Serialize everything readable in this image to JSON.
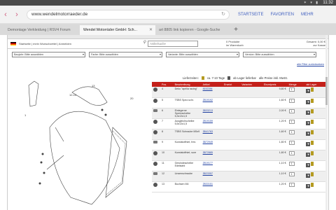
{
  "statusbar": {
    "time": "11:32",
    "icons": "✶ ▾ ▮"
  },
  "browser": {
    "url": "www.wendelmotorraeder.de",
    "links": [
      "STARTSEITE",
      "FAVORITEN",
      "MEHR"
    ],
    "tabs": [
      {
        "label": "Demontage Verkleidung | RSV4 Forum"
      },
      {
        "label": "Wendel Motorräder GmbH: Sch..."
      },
      {
        "label": "art 8805 link kopieren - Google-Suche"
      }
    ]
  },
  "site": {
    "nav": "Startseite | mein Wunschzettel | Anmelden",
    "search_placeholder": "Artikelsuche",
    "cart_line1": "0 Produkte",
    "cart_line2": "im Warenkorb",
    "total_line1": "Gesamt: 0,00 €",
    "total_line2": "zur Kasse",
    "filters": [
      {
        "label": "Baujahr: Bitte auswählen"
      },
      {
        "label": "Farbe: Bitte auswählen"
      },
      {
        "label": "Variante: Bitte auswählen"
      },
      {
        "label": "Version: Bitte auswählen"
      }
    ],
    "clear_filters": "alle Filter zurücksetzen",
    "legend": {
      "supplier": "Lieferzeiten:",
      "delivery": "ca. 7-10 Tage",
      "in_stock": "ab Lager lieferbar",
      "prices": "alle Preise inkl. MwSt."
    }
  },
  "table": {
    "headers": [
      "Pos.",
      "Beschreibung",
      "Artikel",
      "Ersetzt",
      "Varianten",
      "Einzelpreis",
      "Menge",
      "akt Lager"
    ],
    "rows": [
      {
        "pos": "4",
        "desc": "Deko \"aprilia racing\"",
        "art": "8152284",
        "price": "9,80 €",
        "qty": "1"
      },
      {
        "pos": "5",
        "desc": "TSBS Spez.schr.",
        "art": "2B19192",
        "price": "1,60 €",
        "qty": "1"
      },
      {
        "pos": "6",
        "desc": "Einlegerne Spreizscheibe 5,3x13x1,5",
        "art": "3B33213",
        "price": "2,00 €",
        "qty": "1"
      },
      {
        "pos": "7",
        "desc": "Ausgleichscheibe 5,5x13x1,5",
        "art": "2B19159",
        "price": "1,20 €",
        "qty": "1"
      },
      {
        "pos": "8",
        "desc": "TSBS Schraube M5x9",
        "art": "3B41763",
        "price": "1,60 €",
        "qty": "1"
      },
      {
        "pos": "9",
        "desc": "Kunststoffniet, fres",
        "art": "3B72949",
        "price": "1,80 €",
        "qty": "1"
      },
      {
        "pos": "10",
        "desc": "Kunststoffniet, sure",
        "art": "3B72885",
        "price": "1,80 €",
        "qty": "1"
      },
      {
        "pos": "11",
        "desc": "Gewindescheibe Edelstahl",
        "art": "2B19177",
        "price": "1,10 €",
        "qty": "1"
      },
      {
        "pos": "12",
        "desc": "Linsenschraube",
        "art": "3B23357",
        "price": "1,10 €",
        "qty": "1"
      },
      {
        "pos": "13",
        "desc": "Buchsen M4",
        "art": "2B33151",
        "price": "1,20 €",
        "qty": "1"
      }
    ]
  },
  "diagram_labels": [
    "12-15",
    "13",
    "20",
    "1"
  ]
}
